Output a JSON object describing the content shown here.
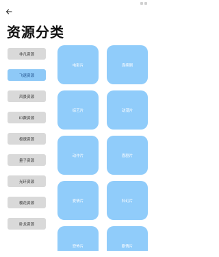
{
  "header": {
    "title": "资源分类"
  },
  "colors": {
    "accent": "#8ec9f7",
    "tile": "#90ccfa",
    "item_bg": "#d9d9d9"
  },
  "categories": [
    {
      "label": "非凡资源",
      "active": false
    },
    {
      "label": "飞速资源",
      "active": true
    },
    {
      "label": "风景资源",
      "active": false
    },
    {
      "label": "ID数资源",
      "active": false
    },
    {
      "label": "极速资源",
      "active": false
    },
    {
      "label": "量子资源",
      "active": false
    },
    {
      "label": "光环资源",
      "active": false
    },
    {
      "label": "樱花资源",
      "active": false
    },
    {
      "label": "卧龙资源",
      "active": false
    }
  ],
  "tiles": [
    {
      "label": "电影片"
    },
    {
      "label": "连续剧"
    },
    {
      "label": "综艺片"
    },
    {
      "label": "动漫片"
    },
    {
      "label": "动作片"
    },
    {
      "label": "喜剧片"
    },
    {
      "label": "爱情片"
    },
    {
      "label": "科幻片"
    },
    {
      "label": "恐怖片"
    },
    {
      "label": "剧情片"
    }
  ]
}
